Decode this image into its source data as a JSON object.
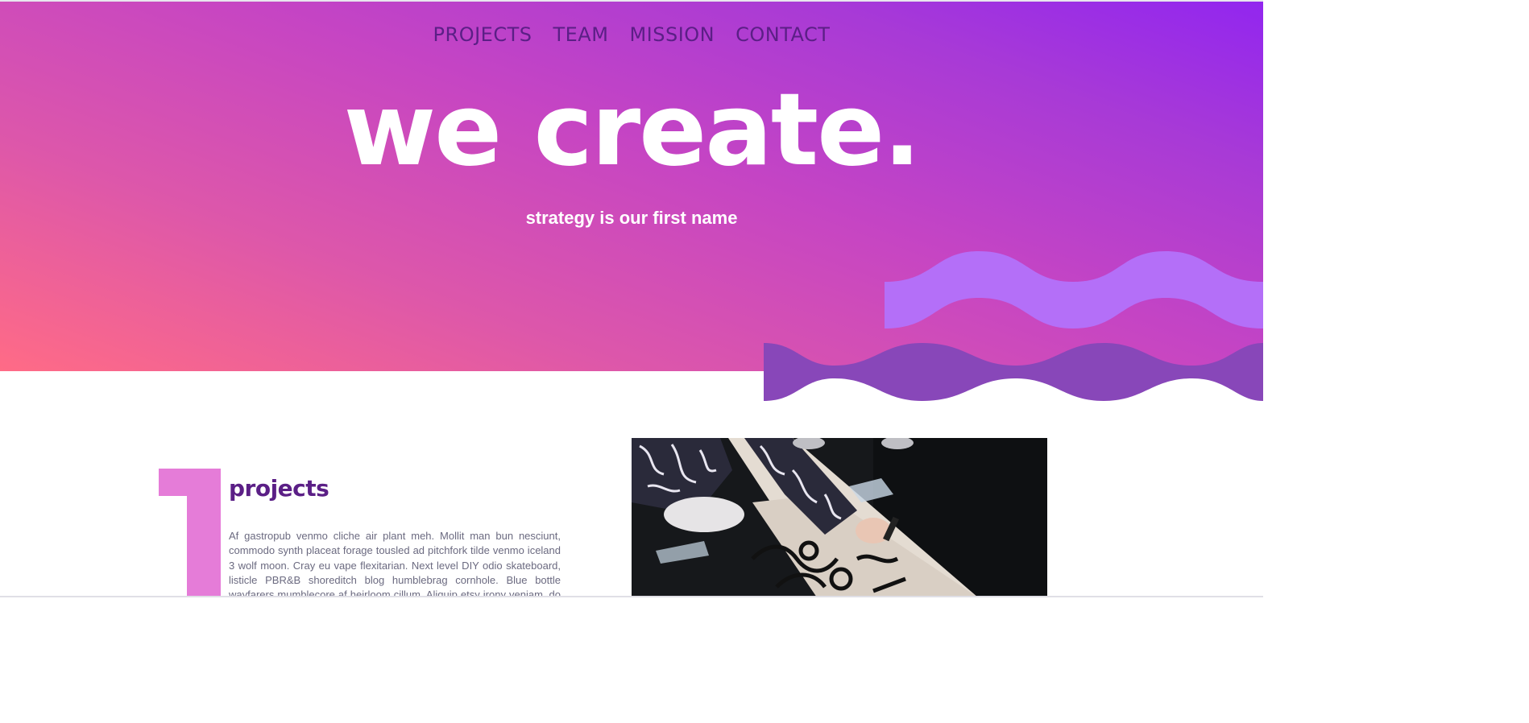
{
  "nav": {
    "items": [
      {
        "label": "PROJECTS"
      },
      {
        "label": "TEAM"
      },
      {
        "label": "MISSION"
      },
      {
        "label": "CONTACT"
      }
    ]
  },
  "hero": {
    "title": "we create.",
    "subtitle": "strategy is our first name"
  },
  "projects": {
    "number": "1",
    "title": "projects",
    "body": "Af gastropub venmo cliche air plant meh. Mollit man bun nesciunt, commodo synth placeat forage tousled ad pitchfork tilde venmo iceland 3 wolf moon. Cray eu vape flexitarian. Next level DIY odio skateboard, listicle PBR&B shoreditch blog humblebrag cornhole. Blue bottle wayfarers mumblecore af heirloom cillum. Aliquip etsy irony veniam, do whatever."
  },
  "colors": {
    "nav_text": "#5b1f86",
    "wave_light": "#b46ff8",
    "wave_dark": "#8847b9",
    "number_pink": "#e57cd8",
    "heading_purple": "#5b1f86"
  }
}
